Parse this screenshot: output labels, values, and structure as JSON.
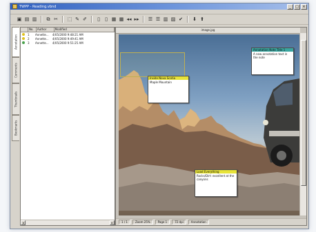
{
  "window": {
    "title": "TWPP - Reading.vbnd",
    "controls": [
      "_",
      "□",
      "×"
    ]
  },
  "toolbar": {
    "groups": [
      [
        "open-icon",
        "save-icon",
        "print-icon"
      ],
      [
        "copy-icon",
        "cut-icon"
      ],
      [
        "select-icon",
        "pen-icon",
        "marker-icon"
      ],
      [
        "page-icon",
        "page-icon",
        "document-icon",
        "document-icon",
        "rewind-icon",
        "forward-icon"
      ],
      [
        "list-icon",
        "list-icon",
        "print-icon",
        "image-icon",
        "check-icon"
      ],
      [
        "down-icon",
        "pin-icon"
      ]
    ],
    "glyphs": {
      "open-icon": "▣",
      "save-icon": "▤",
      "print-icon": "▥",
      "copy-icon": "⧉",
      "cut-icon": "✂",
      "select-icon": "⬚",
      "pen-icon": "✎",
      "marker-icon": "✐",
      "page-icon": "▯",
      "document-icon": "▦",
      "rewind-icon": "◂◂",
      "forward-icon": "▸▸",
      "list-icon": "☰",
      "image-icon": "▨",
      "check-icon": "✔",
      "down-icon": "⬇",
      "pin-icon": "⬆"
    }
  },
  "side_tabs": [
    "Annotation",
    "Comments",
    "Thumbnails",
    "Bookmarks"
  ],
  "list": {
    "columns": [
      "",
      "No.",
      "Author",
      "Modified"
    ],
    "rows": [
      {
        "color": "#e0c21e",
        "num": "1",
        "author": "Annette...",
        "modified": "4/05/2000 9:48:21 AM"
      },
      {
        "color": "#e0c21e",
        "num": "2",
        "author": "Annette...",
        "modified": "4/05/2000 9:49:41 AM"
      },
      {
        "color": "#47a04a",
        "num": "3",
        "author": "Annette...",
        "modified": "4/05/2000 9:51:25 AM"
      }
    ]
  },
  "doc": {
    "ruler_label": "image.jpg"
  },
  "notes": [
    {
      "id": "note1",
      "title": "Inside Nova Scotia",
      "title_color": "#e7e338",
      "body": "Maple Mountain"
    },
    {
      "id": "note2",
      "title": "Annotation Note Title 1",
      "title_color": "#3aa59f",
      "body": "A new annotation text in the note"
    },
    {
      "id": "note3",
      "title": "Load Everything",
      "title_color": "#e7e338",
      "body": "Rocks/Dirt: excellent at the canyons"
    }
  ],
  "status": [
    "1 / 1",
    "Zoom 25%",
    "Page 1",
    "72 dpi",
    "Annotation"
  ]
}
